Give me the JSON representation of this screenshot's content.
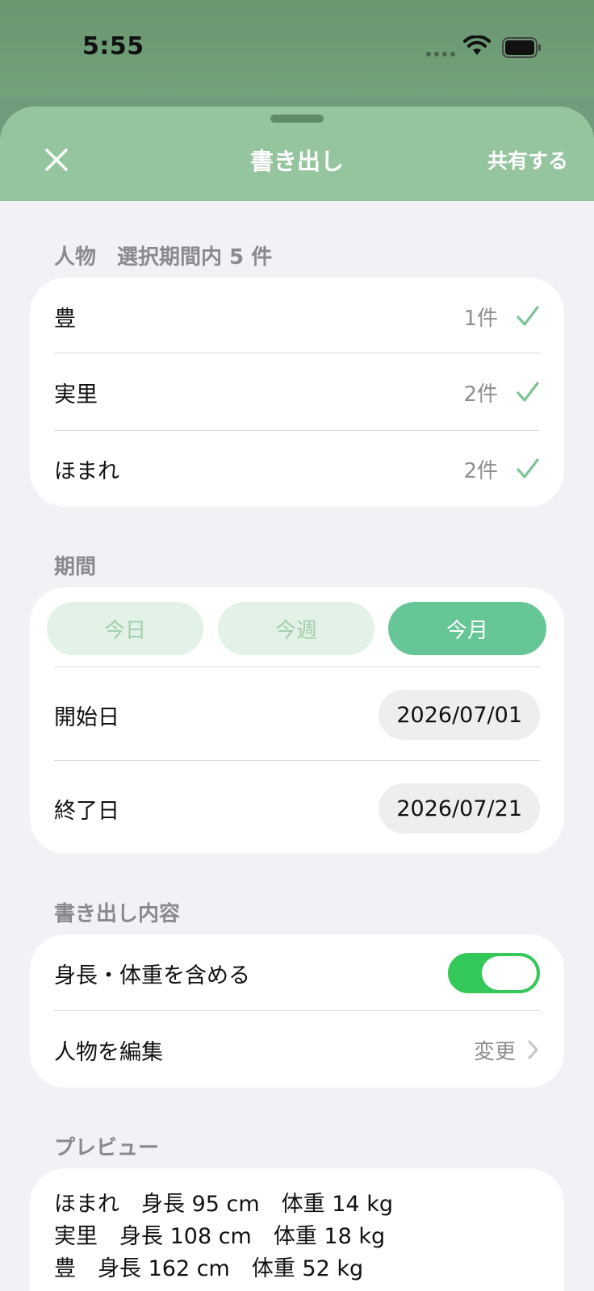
{
  "status": {
    "time": "5:55"
  },
  "nav": {
    "title": "書き出し",
    "share": "共有する"
  },
  "people": {
    "header": "人物　選択期間内 5 件",
    "items": [
      {
        "name": "豊",
        "count": "1件"
      },
      {
        "name": "実里",
        "count": "2件"
      },
      {
        "name": "ほまれ",
        "count": "2件"
      }
    ]
  },
  "period": {
    "header": "期間",
    "segments": [
      "今日",
      "今週",
      "今月"
    ],
    "selected": "今月",
    "start_label": "開始日",
    "start_value": "2026/07/01",
    "end_label": "終了日",
    "end_value": "2026/07/21"
  },
  "content": {
    "header": "書き出し内容",
    "include_label": "身長・体重を含める",
    "include_on": true,
    "edit_label": "人物を編集",
    "edit_action": "変更"
  },
  "preview": {
    "header": "プレビュー",
    "lines": [
      "ほまれ　身長 95 cm　体重 14 kg",
      "実里　身長 108 cm　体重 18 kg",
      "豊　身長 162 cm　体重 52 kg"
    ]
  },
  "colors": {
    "accent": "#66c696",
    "nav": "#95c59f",
    "toggle": "#34c759",
    "check": "#7cc493"
  }
}
